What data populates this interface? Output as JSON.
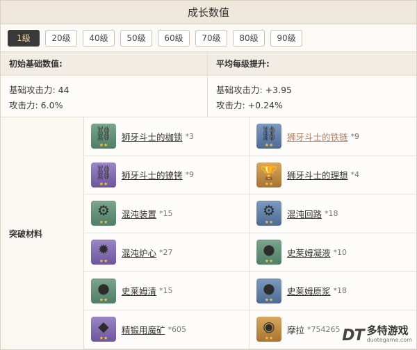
{
  "title": "成长数值",
  "levels": [
    "1级",
    "20级",
    "40级",
    "50级",
    "60级",
    "70级",
    "80级",
    "90级"
  ],
  "active_level": "1级",
  "stats": {
    "left_header": "初始基础数值:",
    "right_header": "平均每级提升:",
    "left_lines": [
      "基础攻击力: 44",
      "攻击力: 6.0%"
    ],
    "right_lines": [
      "基础攻击力: +3.95",
      "攻击力: +0.24%"
    ]
  },
  "materials": {
    "label": "突破材料",
    "items": [
      {
        "name": "狮牙斗士的枷锁",
        "count": "*3",
        "rarity": "green",
        "icon": "shackle-icon"
      },
      {
        "name": "狮牙斗士的铁链",
        "count": "*9",
        "rarity": "blue",
        "icon": "chain-icon"
      },
      {
        "name": "狮牙斗士的镣铐",
        "count": "*9",
        "rarity": "purple",
        "icon": "fetters-icon"
      },
      {
        "name": "狮牙斗士的理想",
        "count": "*4",
        "rarity": "gold",
        "icon": "ideal-icon"
      },
      {
        "name": "混沌装置",
        "count": "*15",
        "rarity": "green",
        "icon": "chaos-device-icon"
      },
      {
        "name": "混沌回路",
        "count": "*18",
        "rarity": "blue",
        "icon": "chaos-circuit-icon"
      },
      {
        "name": "混沌炉心",
        "count": "*27",
        "rarity": "purple",
        "icon": "chaos-core-icon"
      },
      {
        "name": "史莱姆凝液",
        "count": "*10",
        "rarity": "green",
        "icon": "slime-condensate-icon"
      },
      {
        "name": "史莱姆清",
        "count": "*15",
        "rarity": "green",
        "icon": "slime-secretions-icon"
      },
      {
        "name": "史莱姆原浆",
        "count": "*18",
        "rarity": "blue",
        "icon": "slime-concentrate-icon"
      },
      {
        "name": "精锻用魔矿",
        "count": "*605",
        "rarity": "purple",
        "icon": "mystic-ore-icon"
      },
      {
        "name": "摩拉",
        "count": "*754265",
        "rarity": "gold",
        "icon": "mora-coin-icon"
      }
    ]
  },
  "watermark": {
    "logo": "DT",
    "cn": "多特游戏",
    "en": "duotegame.com"
  },
  "colors": {
    "active_tab_bg": "#3b3a3a",
    "active_tab_text": "#f2d7a1",
    "header_bg": "#ede7dc",
    "star": "#f3c64a"
  }
}
